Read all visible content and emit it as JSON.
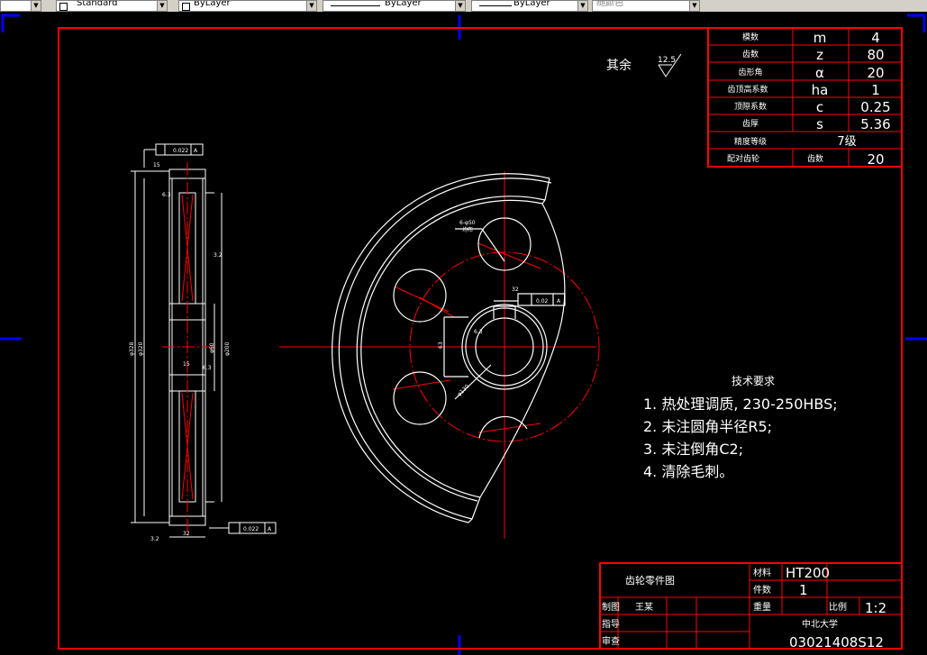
{
  "toolbar": {
    "style_value": "Standard",
    "layer_value": "ByLayer",
    "linetype_value": "ByLayer",
    "lineweight_value": "ByLayer",
    "color_value": "随颜色"
  },
  "param_table": {
    "rows": [
      {
        "label": "模数",
        "symbol": "m",
        "value": "4"
      },
      {
        "label": "齿数",
        "symbol": "z",
        "value": "80"
      },
      {
        "label": "齿形角",
        "symbol": "α",
        "value": "20"
      },
      {
        "label": "齿顶高系数",
        "symbol": "ha",
        "value": "1"
      },
      {
        "label": "顶隙系数",
        "symbol": "c",
        "value": "0.25"
      },
      {
        "label": "齿厚",
        "symbol": "s",
        "value": "5.36"
      }
    ],
    "grade_label": "精度等级",
    "grade_value": "7级",
    "mate_label": "配对齿轮",
    "mate_sub_label": "齿数",
    "mate_value": "20"
  },
  "roughness": {
    "prefix": "其余",
    "value": "12.5"
  },
  "tech_requirements": {
    "title": "技术要求",
    "items": [
      "1. 热处理调质, 230-250HBS;",
      "2. 未注圆角半径R5;",
      "3. 未注倒角C2;",
      "4. 清除毛刺。"
    ]
  },
  "title_block": {
    "drawing_name": "齿轮零件图",
    "material_label": "材料",
    "material_value": "HT200",
    "qty_label": "件数",
    "qty_value": "1",
    "weight_label": "重量",
    "scale_label": "比例",
    "scale_value": "1:2",
    "drawn_label": "制图",
    "drawn_value": "王某",
    "guide_label": "指导",
    "review_label": "审查",
    "school": "中北大学",
    "drawing_number": "03021408S12"
  },
  "side_view": {
    "tol1": "0.022",
    "datum": "A",
    "tol2": "0.022",
    "dim_top": "15",
    "dim_bottom_width": "32",
    "dim_mid": "15",
    "dia1": "φ328",
    "dia2": "φ320",
    "dia3": "φ60",
    "dia4": "φ200",
    "rough_a": "3.2",
    "rough_b": "6.3",
    "rough_c": "3.2",
    "rough_d": "6.3"
  },
  "front_view": {
    "holes_note": "6-φ50",
    "holes_note2": "均布",
    "keyway_width": "32",
    "keyway_tol": "0.02",
    "keyway_datum": "A",
    "keyway_depth": "63",
    "pcd": "φ130",
    "rough_e": "6.3"
  },
  "colors": {
    "frame": "#ff0000",
    "lines": "#ffffff",
    "center": "#ff0000",
    "marker": "#0000ff"
  }
}
